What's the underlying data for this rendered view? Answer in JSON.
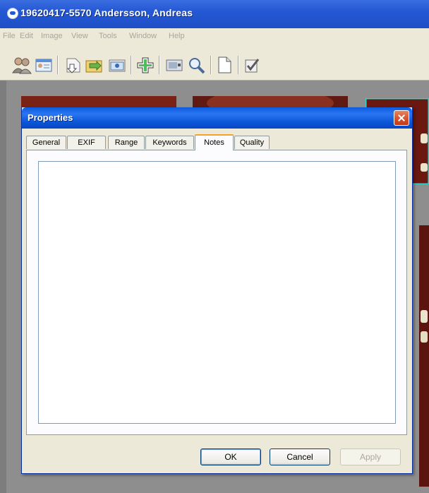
{
  "window": {
    "title": "19620417-5570 Andersson, Andreas"
  },
  "menu": [
    "File",
    "Edit",
    "Image",
    "View",
    "Tools",
    "Window",
    "Help"
  ],
  "toolbar": {
    "buttons": [
      "patients-icon",
      "patient-card-icon",
      "import-icon",
      "export-icon",
      "camera-icon",
      "add-icon",
      "display-icon",
      "zoom-icon",
      "document-icon",
      "checklist-icon"
    ]
  },
  "dialog": {
    "title": "Properties",
    "tabs": [
      "General",
      "EXIF",
      "Range",
      "Keywords",
      "Notes",
      "Quality"
    ],
    "active_tab": "Notes",
    "notes_value": "",
    "buttons": {
      "ok": "OK",
      "cancel": "Cancel",
      "apply": "Apply"
    }
  }
}
